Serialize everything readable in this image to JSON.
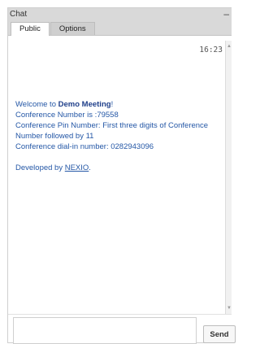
{
  "header": {
    "title": "Chat",
    "minimize_label": "–",
    "tabs": [
      {
        "label": "Public"
      },
      {
        "label": "Options"
      }
    ]
  },
  "messages": {
    "timestamp": "16:23",
    "welcome_prefix": "Welcome to ",
    "meeting_name": "Demo Meeting",
    "welcome_suffix": "!",
    "conference_number": "Conference Number is :79558",
    "pin_line": "Conference Pin Number: First three digits of Conference Number followed by 11",
    "dialin_line": "Conference dial-in number: 0282943096",
    "developed_prefix": "Developed by ",
    "developer": "NEXIO",
    "developed_suffix": "."
  },
  "composer": {
    "send_label": "Send"
  }
}
